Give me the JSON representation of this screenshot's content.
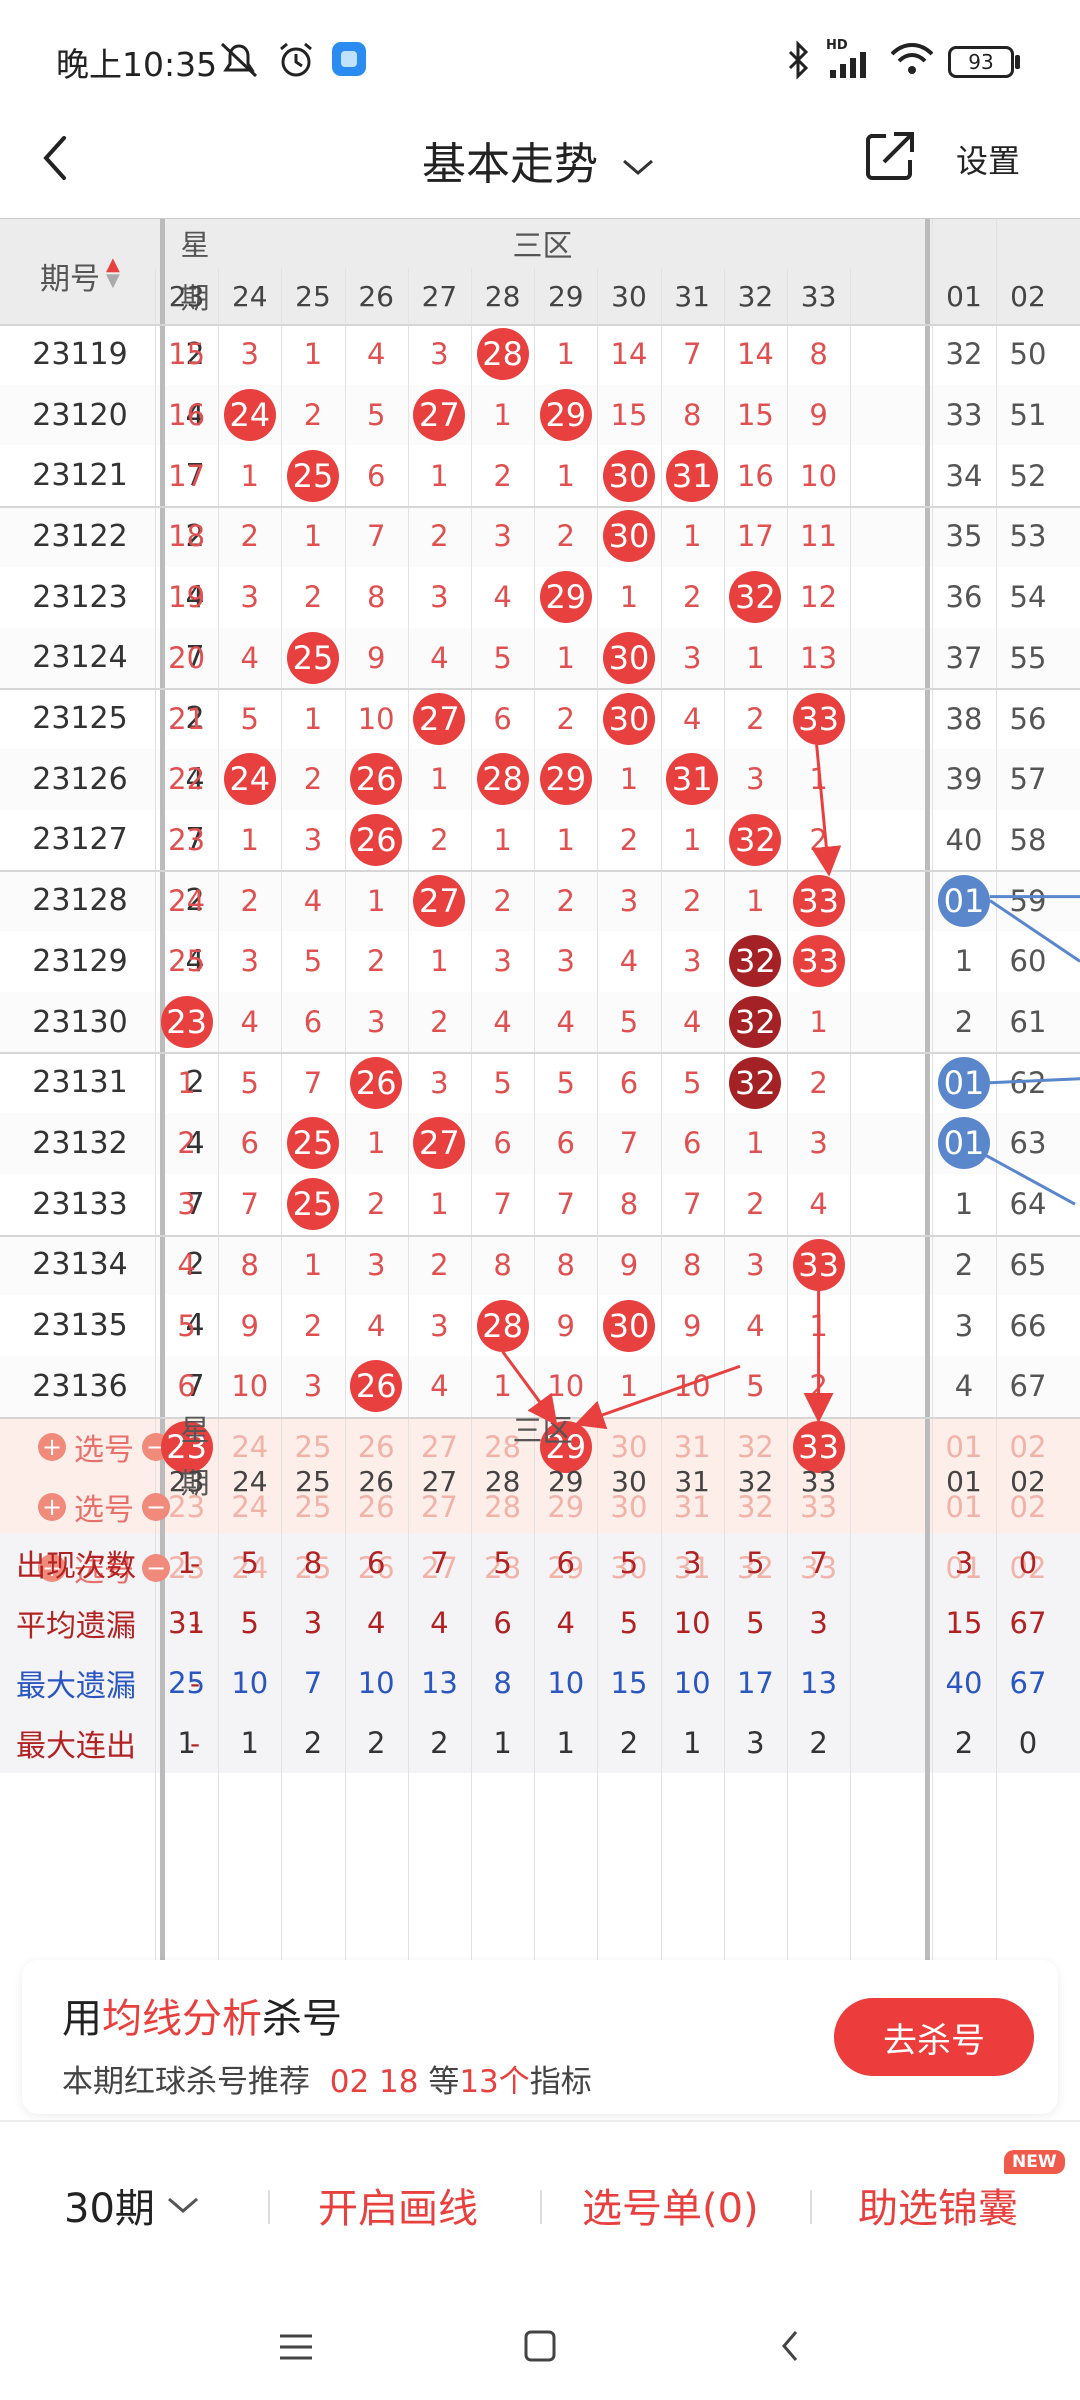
{
  "status": {
    "time": "晚上10:35",
    "battery": "93",
    "hd": "HD"
  },
  "header": {
    "title": "基本走势",
    "settings": "设置"
  },
  "table": {
    "period_header": "期号",
    "week_header_1": "星",
    "week_header_2": "期",
    "zone_label": "三区",
    "columns": [
      "23",
      "24",
      "25",
      "26",
      "27",
      "28",
      "29",
      "30",
      "31",
      "32",
      "33"
    ],
    "blue_columns": [
      "01",
      "02"
    ],
    "rows": [
      {
        "period": "23119",
        "week": "2",
        "cells": [
          "15",
          "3",
          "1",
          "4",
          "3",
          "28",
          "1",
          "14",
          "7",
          "14",
          "8"
        ],
        "hits": [
          5
        ],
        "dark": [],
        "blue": [
          "32",
          "50"
        ],
        "blue_hit": []
      },
      {
        "period": "23120",
        "week": "4",
        "cells": [
          "16",
          "24",
          "2",
          "5",
          "27",
          "1",
          "29",
          "15",
          "8",
          "15",
          "9"
        ],
        "hits": [
          1,
          4,
          6
        ],
        "dark": [],
        "blue": [
          "33",
          "51"
        ],
        "blue_hit": []
      },
      {
        "period": "23121",
        "week": "7",
        "cells": [
          "17",
          "1",
          "25",
          "6",
          "1",
          "2",
          "1",
          "30",
          "31",
          "16",
          "10"
        ],
        "hits": [
          2,
          7,
          8
        ],
        "dark": [],
        "blue": [
          "34",
          "52"
        ],
        "blue_hit": []
      },
      {
        "period": "23122",
        "week": "2",
        "cells": [
          "18",
          "2",
          "1",
          "7",
          "2",
          "3",
          "2",
          "30",
          "1",
          "17",
          "11"
        ],
        "hits": [
          7
        ],
        "dark": [],
        "blue": [
          "35",
          "53"
        ],
        "blue_hit": []
      },
      {
        "period": "23123",
        "week": "4",
        "cells": [
          "19",
          "3",
          "2",
          "8",
          "3",
          "4",
          "29",
          "1",
          "2",
          "32",
          "12"
        ],
        "hits": [
          6,
          9
        ],
        "dark": [],
        "blue": [
          "36",
          "54"
        ],
        "blue_hit": []
      },
      {
        "period": "23124",
        "week": "7",
        "cells": [
          "20",
          "4",
          "25",
          "9",
          "4",
          "5",
          "1",
          "30",
          "3",
          "1",
          "13"
        ],
        "hits": [
          2,
          7
        ],
        "dark": [],
        "blue": [
          "37",
          "55"
        ],
        "blue_hit": []
      },
      {
        "period": "23125",
        "week": "2",
        "cells": [
          "21",
          "5",
          "1",
          "10",
          "27",
          "6",
          "2",
          "30",
          "4",
          "2",
          "33"
        ],
        "hits": [
          4,
          7,
          10
        ],
        "dark": [],
        "blue": [
          "38",
          "56"
        ],
        "blue_hit": []
      },
      {
        "period": "23126",
        "week": "4",
        "cells": [
          "22",
          "24",
          "2",
          "26",
          "1",
          "28",
          "29",
          "1",
          "31",
          "3",
          "1"
        ],
        "hits": [
          1,
          3,
          5,
          6,
          8
        ],
        "dark": [],
        "blue": [
          "39",
          "57"
        ],
        "blue_hit": []
      },
      {
        "period": "23127",
        "week": "7",
        "cells": [
          "23",
          "1",
          "3",
          "26",
          "2",
          "1",
          "1",
          "2",
          "1",
          "32",
          "2"
        ],
        "hits": [
          3,
          9
        ],
        "dark": [],
        "blue": [
          "40",
          "58"
        ],
        "blue_hit": []
      },
      {
        "period": "23128",
        "week": "2",
        "cells": [
          "24",
          "2",
          "4",
          "1",
          "27",
          "2",
          "2",
          "3",
          "2",
          "1",
          "33"
        ],
        "hits": [
          4,
          10
        ],
        "dark": [],
        "blue": [
          "01",
          "59"
        ],
        "blue_hit": [
          0
        ]
      },
      {
        "period": "23129",
        "week": "4",
        "cells": [
          "25",
          "3",
          "5",
          "2",
          "1",
          "3",
          "3",
          "4",
          "3",
          "32",
          "33"
        ],
        "hits": [
          10
        ],
        "dark": [
          9
        ],
        "blue": [
          "1",
          "60"
        ],
        "blue_hit": []
      },
      {
        "period": "23130",
        "week": "7",
        "cells": [
          "23",
          "4",
          "6",
          "3",
          "2",
          "4",
          "4",
          "5",
          "4",
          "32",
          "1"
        ],
        "hits": [
          0
        ],
        "dark": [
          9
        ],
        "blue": [
          "2",
          "61"
        ],
        "blue_hit": []
      },
      {
        "period": "23131",
        "week": "2",
        "cells": [
          "1",
          "5",
          "7",
          "26",
          "3",
          "5",
          "5",
          "6",
          "5",
          "32",
          "2"
        ],
        "hits": [
          3
        ],
        "dark": [
          9
        ],
        "blue": [
          "01",
          "62"
        ],
        "blue_hit": [
          0
        ]
      },
      {
        "period": "23132",
        "week": "4",
        "cells": [
          "2",
          "6",
          "25",
          "1",
          "27",
          "6",
          "6",
          "7",
          "6",
          "1",
          "3"
        ],
        "hits": [
          2,
          4
        ],
        "dark": [],
        "blue": [
          "01",
          "63"
        ],
        "blue_hit": [
          0
        ]
      },
      {
        "period": "23133",
        "week": "7",
        "cells": [
          "3",
          "7",
          "25",
          "2",
          "1",
          "7",
          "7",
          "8",
          "7",
          "2",
          "4"
        ],
        "hits": [
          2
        ],
        "dark": [],
        "blue": [
          "1",
          "64"
        ],
        "blue_hit": []
      },
      {
        "period": "23134",
        "week": "2",
        "cells": [
          "4",
          "8",
          "1",
          "3",
          "2",
          "8",
          "8",
          "9",
          "8",
          "3",
          "33"
        ],
        "hits": [
          10
        ],
        "dark": [],
        "blue": [
          "2",
          "65"
        ],
        "blue_hit": []
      },
      {
        "period": "23135",
        "week": "4",
        "cells": [
          "5",
          "9",
          "2",
          "4",
          "3",
          "28",
          "9",
          "30",
          "9",
          "4",
          "1"
        ],
        "hits": [
          5,
          7
        ],
        "dark": [],
        "blue": [
          "3",
          "66"
        ],
        "blue_hit": []
      },
      {
        "period": "23136",
        "week": "7",
        "cells": [
          "6",
          "10",
          "3",
          "26",
          "4",
          "1",
          "10",
          "1",
          "10",
          "5",
          "2"
        ],
        "hits": [
          3
        ],
        "dark": [],
        "blue": [
          "4",
          "67"
        ],
        "blue_hit": []
      }
    ],
    "pick_label": "选号",
    "pick_rows": [
      {
        "cells": [
          "23",
          "24",
          "25",
          "26",
          "27",
          "28",
          "29",
          "30",
          "31",
          "32",
          "33"
        ],
        "hits": [
          0,
          6,
          10
        ],
        "blue": [
          "01",
          "02"
        ]
      },
      {
        "cells": [
          "23",
          "24",
          "25",
          "26",
          "27",
          "28",
          "29",
          "30",
          "31",
          "32",
          "33"
        ],
        "hits": [],
        "blue": [
          "01",
          "02"
        ]
      },
      {
        "cells": [
          "23",
          "24",
          "25",
          "26",
          "27",
          "28",
          "29",
          "30",
          "31",
          "32",
          "33"
        ],
        "hits": [],
        "blue": [
          "01",
          "02"
        ]
      }
    ],
    "stats_dash": "-",
    "stats": [
      {
        "label": "出现次数",
        "dash": "-",
        "values": [
          "1",
          "5",
          "8",
          "6",
          "7",
          "5",
          "6",
          "5",
          "3",
          "5",
          "7"
        ],
        "blue": [
          "3",
          "0"
        ],
        "label_color": "#b22222",
        "value_color": "#b22222"
      },
      {
        "label": "平均遗漏",
        "dash": "-",
        "values": [
          "31",
          "5",
          "3",
          "4",
          "4",
          "6",
          "4",
          "5",
          "10",
          "5",
          "3"
        ],
        "blue": [
          "15",
          "67"
        ],
        "label_color": "#b22222",
        "value_color": "#b22222"
      },
      {
        "label": "最大遗漏",
        "dash": "-",
        "values": [
          "25",
          "10",
          "7",
          "10",
          "13",
          "8",
          "10",
          "15",
          "10",
          "17",
          "13"
        ],
        "blue": [
          "40",
          "67"
        ],
        "label_color": "#2a56c0",
        "value_color": "#2a56c0"
      },
      {
        "label": "最大连出",
        "dash": "-",
        "values": [
          "1",
          "1",
          "2",
          "2",
          "2",
          "1",
          "1",
          "2",
          "1",
          "3",
          "2"
        ],
        "blue": [
          "2",
          "0"
        ],
        "label_color": "#b22222",
        "value_color": "#333333"
      }
    ]
  },
  "promo": {
    "title_prefix": "用",
    "title_highlight": "均线分析",
    "title_suffix": "杀号",
    "subtitle_prefix": "本期红球杀号推荐",
    "subtitle_nums": "02 18",
    "subtitle_mid": "等",
    "subtitle_count": "13个",
    "subtitle_suffix": "指标",
    "button": "去杀号"
  },
  "bottom": {
    "periods": "30期",
    "draw_line": "开启画线",
    "pick_list": "选号单(0)",
    "helper": "助选锦囊",
    "new_badge": "NEW"
  },
  "colors": {
    "red_ball": "#e8403f",
    "dark_ball": "#a42225",
    "blue_ball": "#5a86cc",
    "accent": "#e8403f"
  }
}
